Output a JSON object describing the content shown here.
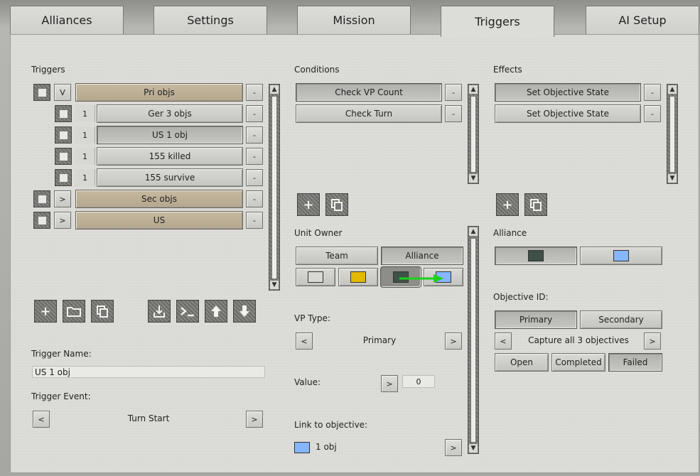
{
  "tabs": [
    "Alliances",
    "Settings",
    "Mission",
    "Triggers",
    "AI Setup"
  ],
  "triggers": {
    "heading": "Triggers",
    "items": [
      {
        "prefix": "V",
        "label": "Pri objs",
        "remove": "-"
      },
      {
        "prefix": "1",
        "label": "Ger 3 objs",
        "remove": "-"
      },
      {
        "prefix": "1",
        "label": "US 1 obj",
        "remove": "-"
      },
      {
        "prefix": "1",
        "label": "155 killed",
        "remove": "-"
      },
      {
        "prefix": "1",
        "label": "155 survive",
        "remove": "-"
      },
      {
        "prefix": ">",
        "label": "Sec objs",
        "remove": "-"
      },
      {
        "prefix": ">",
        "label": "US",
        "remove": "-"
      }
    ],
    "name_label": "Trigger Name:",
    "name_value": "US 1 obj",
    "event_label": "Trigger Event:",
    "event_prev": "<",
    "event_value": "Turn Start",
    "event_next": ">"
  },
  "conditions": {
    "heading": "Conditions",
    "items": [
      {
        "label": "Check VP Count",
        "remove": "-"
      },
      {
        "label": "Check Turn",
        "remove": "-"
      }
    ],
    "unit_owner_label": "Unit Owner",
    "team_label": "Team",
    "alliance_label": "Alliance",
    "vp_type_label": "VP Type:",
    "vp_prev": "<",
    "vp_value": "Primary",
    "vp_next": ">",
    "value_label": "Value:",
    "value_btn": ">",
    "value_value": "0",
    "link_label": "Link to objective:",
    "link_value": "1 obj",
    "link_next": ">"
  },
  "effects": {
    "heading": "Effects",
    "items": [
      {
        "label": "Set Objective State",
        "remove": "-"
      },
      {
        "label": "Set Objective State",
        "remove": "-"
      }
    ],
    "alliance_label": "Alliance",
    "objective_id_label": "Objective ID:",
    "primary_label": "Primary",
    "secondary_label": "Secondary",
    "obj_prev": "<",
    "obj_value": "Capture all 3 objectives",
    "obj_next": ">",
    "open_label": "Open",
    "completed_label": "Completed",
    "failed_label": "Failed"
  },
  "colors": {
    "owner_white": "#d8d8d4",
    "owner_yellow": "#e2b800",
    "owner_dark": "#3f5048",
    "owner_blue": "#86b6ff",
    "link_blue": "#86b6ff",
    "drag_arrow": "#19d219"
  },
  "icons": {
    "add": "plus-icon",
    "copy": "copy-icon",
    "folder": "folder-icon",
    "import": "import-icon",
    "console": "console-icon",
    "move_up": "arrow-up-icon",
    "move_down": "arrow-down-icon"
  }
}
